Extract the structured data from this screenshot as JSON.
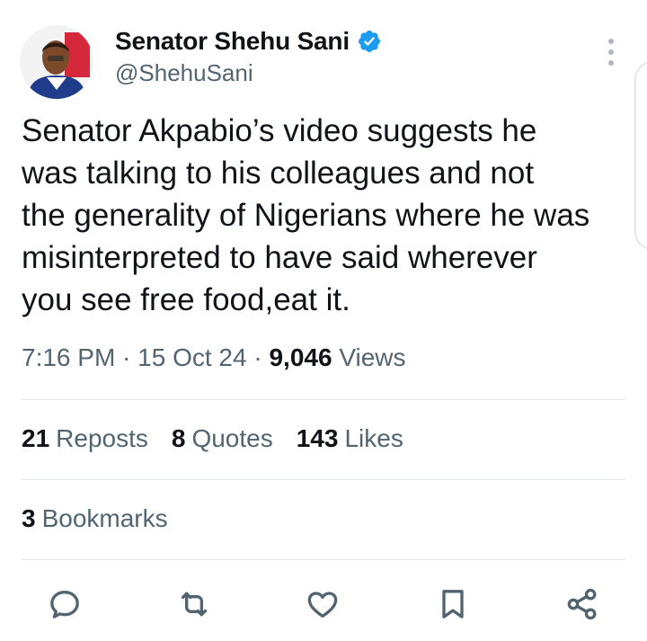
{
  "author": {
    "name": "Senator Shehu Sani",
    "handle": "@ShehuSani",
    "verified_color": "#1d9bf0"
  },
  "tweet": {
    "text": "Senator Akpabio’s video suggests he\nwas talking to his colleagues and not\nthe generality of Nigerians where he was\nmisinterpreted to have said wherever\nyou see free food,eat it."
  },
  "meta": {
    "time": "7:16 PM",
    "sep1": " · ",
    "date": "15 Oct 24",
    "sep2": " · ",
    "views_count": "9,046",
    "views_label": " Views"
  },
  "stats": {
    "reposts_count": "21",
    "reposts_label": "Reposts",
    "quotes_count": "8",
    "quotes_label": "Quotes",
    "likes_count": "143",
    "likes_label": "Likes",
    "bookmarks_count": "3",
    "bookmarks_label": "Bookmarks"
  },
  "actions": {
    "icons": [
      "reply-icon",
      "repost-icon",
      "like-icon",
      "bookmark-icon",
      "share-icon"
    ],
    "icon_color": "#536471"
  }
}
